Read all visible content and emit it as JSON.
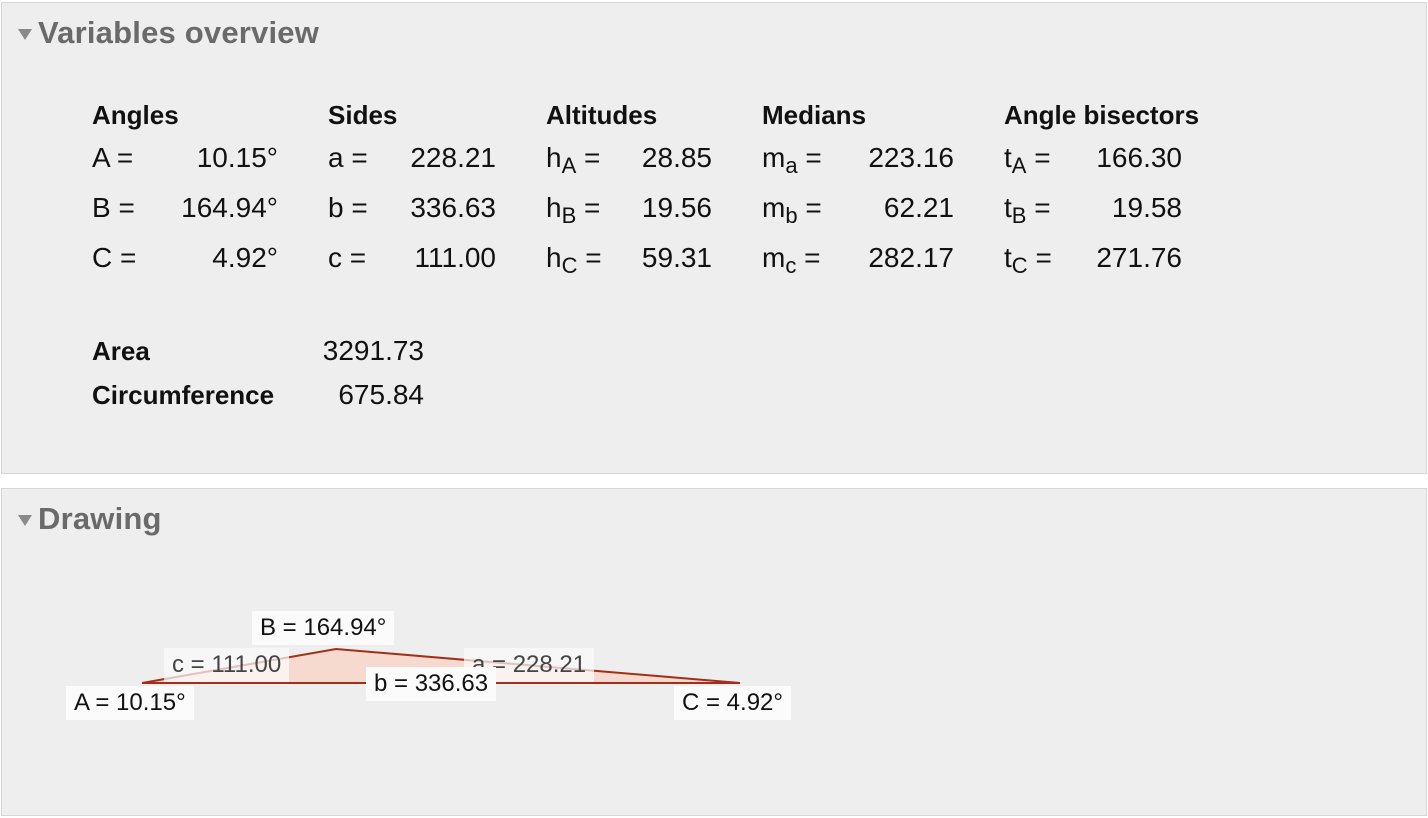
{
  "variables_panel": {
    "title": "Variables overview",
    "angles": {
      "header": "Angles",
      "rows": [
        {
          "label": "A =",
          "value": "10.15°"
        },
        {
          "label": "B =",
          "value": "164.94°"
        },
        {
          "label": "C =",
          "value": "4.92°"
        }
      ]
    },
    "sides": {
      "header": "Sides",
      "rows": [
        {
          "label": "a =",
          "value": "228.21"
        },
        {
          "label": "b =",
          "value": "336.63"
        },
        {
          "label": "c =",
          "value": "111.00"
        }
      ]
    },
    "altitudes": {
      "header": "Altitudes",
      "rows": [
        {
          "sym": "h",
          "sub": "A",
          "eq": "=",
          "value": "28.85"
        },
        {
          "sym": "h",
          "sub": "B",
          "eq": "=",
          "value": "19.56"
        },
        {
          "sym": "h",
          "sub": "C",
          "eq": "=",
          "value": "59.31"
        }
      ]
    },
    "medians": {
      "header": "Medians",
      "rows": [
        {
          "sym": "m",
          "sub": "a",
          "eq": "=",
          "value": "223.16"
        },
        {
          "sym": "m",
          "sub": "b",
          "eq": "=",
          "value": "62.21"
        },
        {
          "sym": "m",
          "sub": "c",
          "eq": "=",
          "value": "282.17"
        }
      ]
    },
    "angle_bisectors": {
      "header": "Angle bisectors",
      "rows": [
        {
          "sym": "t",
          "sub": "A",
          "eq": "=",
          "value": "166.30"
        },
        {
          "sym": "t",
          "sub": "B",
          "eq": "=",
          "value": "19.58"
        },
        {
          "sym": "t",
          "sub": "C",
          "eq": "=",
          "value": "271.76"
        }
      ]
    },
    "area": {
      "label": "Area",
      "value": "3291.73"
    },
    "circumference": {
      "label": "Circumference",
      "value": "675.84"
    }
  },
  "drawing_panel": {
    "title": "Drawing",
    "labels": {
      "vertex_a": "A = 10.15°",
      "vertex_b": "B = 164.94°",
      "vertex_c": "C = 4.92°",
      "side_a": "a = 228.21",
      "side_b": "b = 336.63",
      "side_c": "c = 111.00"
    },
    "colors": {
      "stroke": "#a0301a",
      "fill": "#f6d9cf"
    }
  }
}
